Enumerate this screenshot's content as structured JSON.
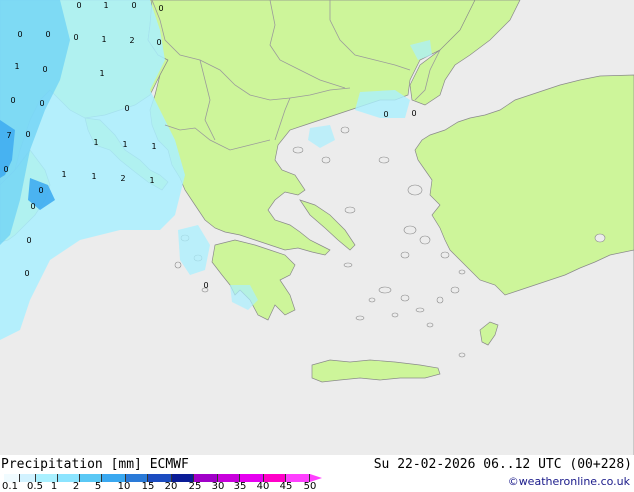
{
  "map": {
    "colors": {
      "sea": "#ececec",
      "land": "#cdf59a",
      "coast": "#8a8a8a",
      "border": "#9b9b9b",
      "precip_light": "#aaf0ff",
      "precip_mid": "#6ed2f5",
      "precip_strong": "#3aa8f0"
    },
    "point_labels": [
      "1",
      "0",
      "0",
      "0",
      "0",
      "0",
      "0",
      "1",
      "2",
      "0",
      "1",
      "0",
      "1",
      "0",
      "0",
      "0",
      "1",
      "7",
      "0",
      "1",
      "1",
      "0",
      "1",
      "1",
      "2",
      "1",
      "0",
      "0",
      "0",
      "0",
      "0",
      "0",
      "0"
    ]
  },
  "legend": {
    "title": "Precipitation [mm]  ECMWF",
    "ticks": [
      "0.1",
      "0.5",
      "1",
      "2",
      "5",
      "10",
      "15",
      "20",
      "25",
      "30",
      "35",
      "40",
      "45",
      "50"
    ],
    "colors": [
      "#f0fbff",
      "#d2f2ff",
      "#aaf0ff",
      "#8ce4ff",
      "#5ac8f5",
      "#3aa8f0",
      "#2a7ad8",
      "#1c4cc0",
      "#0a1c96",
      "#a000c8",
      "#c800dc",
      "#e600f0",
      "#ff00c8",
      "#ff40ff"
    ]
  },
  "valid_time": "Su 22-02-2026 06..12 UTC (00+228)",
  "credit": "©weatheronline.co.uk"
}
